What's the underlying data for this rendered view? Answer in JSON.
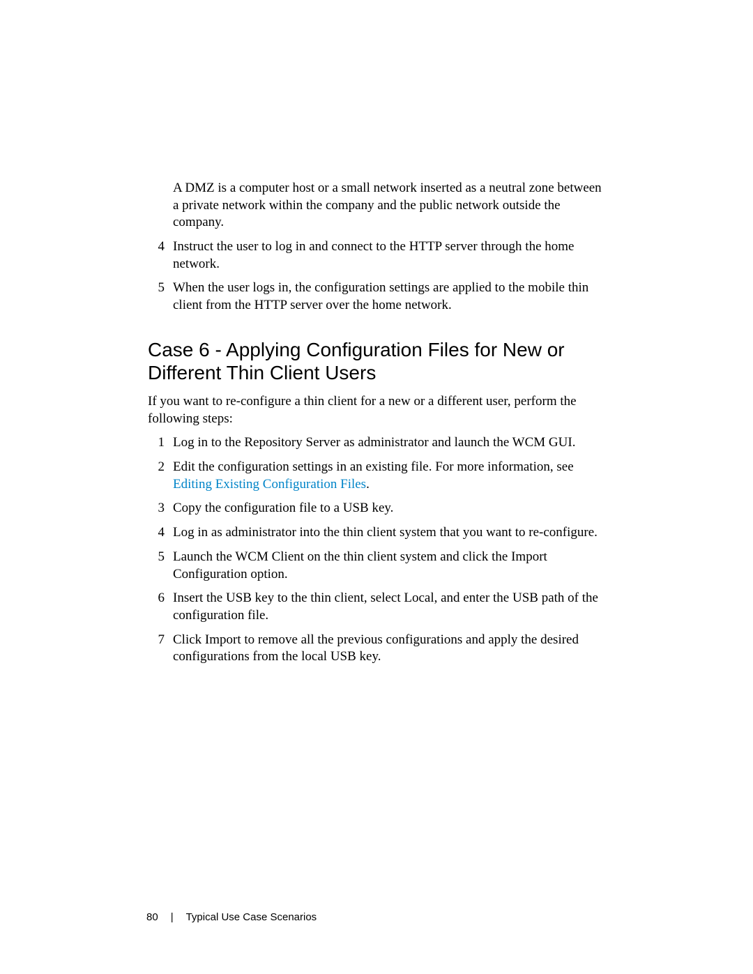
{
  "prev_section": {
    "dmz_para": "A DMZ is a computer host or a small network inserted as a neutral zone between a private network within the company and the public network outside the company.",
    "items": [
      {
        "num": "4",
        "text": "Instruct the user to log in and connect to the HTTP server through the home network."
      },
      {
        "num": "5",
        "text": "When the user logs in, the configuration settings are applied to the mobile thin client from the HTTP server over the home network."
      }
    ]
  },
  "section": {
    "heading": "Case 6 - Applying Configuration Files for New or Different Thin Client Users",
    "intro": "If you want to re-configure a thin client for a new or a different user, perform the following steps:",
    "items": [
      {
        "num": "1",
        "text": "Log in to the Repository Server as administrator and launch the WCM GUI."
      },
      {
        "num": "2",
        "text_prefix": "Edit the configuration settings in an existing file. For more information, see ",
        "link_text": "Editing Existing Configuration Files",
        "text_suffix": "."
      },
      {
        "num": "3",
        "text": "Copy the configuration file to a USB key."
      },
      {
        "num": "4",
        "text": "Log in as administrator into the thin client system that you want to re-configure."
      },
      {
        "num": "5",
        "text": "Launch the WCM Client on the thin client system and click the Import Configuration option."
      },
      {
        "num": "6",
        "text": "Insert the USB key to the thin client, select Local, and enter the USB path of the configuration file."
      },
      {
        "num": "7",
        "text": "Click Import to remove all the previous configurations and apply the desired configurations from the local USB key."
      }
    ]
  },
  "footer": {
    "page_number": "80",
    "divider": "|",
    "chapter": "Typical Use Case Scenarios"
  }
}
